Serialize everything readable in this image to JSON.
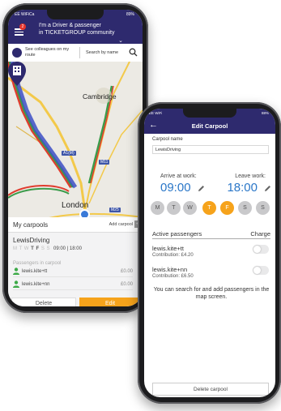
{
  "left_phone": {
    "status": {
      "carrier": "EE WiFiCa",
      "battery": "89%"
    },
    "header": {
      "badge_count": "2",
      "title_line1": "I'm a Driver & passenger",
      "title_line2": "in TICKETGROUP community",
      "chevron": "⌄"
    },
    "search_bar": {
      "see_colleagues": "See colleagues on my route",
      "search_by_name": "Search by name"
    },
    "map": {
      "city_north": "Cambridge",
      "city_south": "London",
      "road_a1m": "A1(M)",
      "road_m11": "M11",
      "road_m25": "M25"
    },
    "panel": {
      "title": "My carpools",
      "add_carpool": "Add carpool",
      "add_icon": "+",
      "carpool_name": "LewisDriving",
      "days": [
        {
          "label": "M",
          "active": false
        },
        {
          "label": "T",
          "active": false
        },
        {
          "label": "W",
          "active": false
        },
        {
          "label": "T",
          "active": true
        },
        {
          "label": "F",
          "active": true
        },
        {
          "label": "S",
          "active": false
        },
        {
          "label": "S",
          "active": false
        }
      ],
      "times": "09:00 | 18:00",
      "passengers_title": "Passengers in carpool",
      "passengers": [
        {
          "name": "lewis.kite+tt",
          "amount": "£0.00"
        },
        {
          "name": "lewis.kite+nn",
          "amount": "£0.00"
        }
      ],
      "delete_label": "Delete",
      "edit_label": "Edit"
    }
  },
  "right_phone": {
    "status": {
      "carrier": "EE WiFi",
      "battery": "88%"
    },
    "header": {
      "title": "Edit Carpool",
      "back_icon": "←"
    },
    "carpool_name_label": "Carpool name",
    "carpool_name_value": "LewisDriving",
    "arrive_label": "Arrive at work:",
    "arrive_time": "09:00",
    "leave_label": "Leave work:",
    "leave_time": "18:00",
    "days": [
      {
        "label": "M",
        "active": false
      },
      {
        "label": "T",
        "active": false
      },
      {
        "label": "W",
        "active": false
      },
      {
        "label": "T",
        "active": true
      },
      {
        "label": "F",
        "active": true
      },
      {
        "label": "S",
        "active": false
      },
      {
        "label": "S",
        "active": false
      }
    ],
    "active_passengers_label": "Active passengers",
    "charge_label": "Charge",
    "passengers": [
      {
        "name": "lewis.kite+tt",
        "contribution": "Contribution: £4.20"
      },
      {
        "name": "lewis.kite+nn",
        "contribution": "Contribution: £6.50"
      }
    ],
    "search_note": "You can search for and add passengers in the map screen.",
    "delete_carpool_label": "Delete carpool"
  },
  "colors": {
    "brand_navy": "#2e2a6e",
    "accent_orange": "#f6a31b",
    "time_blue": "#2b77c8"
  }
}
